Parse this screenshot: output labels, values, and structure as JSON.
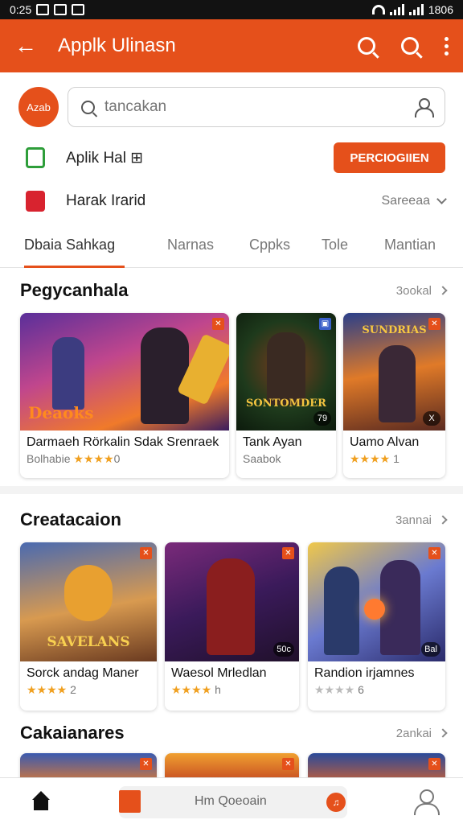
{
  "status_bar": {
    "time": "0:25",
    "battery": "1806"
  },
  "app_bar": {
    "title": "Applk Ulinasn"
  },
  "avatar": {
    "label": "Azab"
  },
  "search": {
    "value": "",
    "placeholder": "tancakan"
  },
  "apps_row": {
    "label": "Aplik Hal ⊞",
    "button": "PERCIOGIIEN"
  },
  "category_row": {
    "label": "Harak Irarid",
    "dropdown": "Sareeaa"
  },
  "tabs": [
    {
      "label": "Dbaia Sahkag",
      "active": true
    },
    {
      "label": "Narnas",
      "active": false
    },
    {
      "label": "Cppks",
      "active": false
    },
    {
      "label": "Tole",
      "active": false
    },
    {
      "label": "Mantian",
      "active": false
    }
  ],
  "sections": [
    {
      "title": "Pegycanhala",
      "see_all": "3ookal",
      "cards": [
        {
          "name": "Darmaeh Rörkalin Sdak Srenraek",
          "meta": "Bolhabie",
          "rating": "★★★★",
          "rating_suffix": "0",
          "art_text": "Deaoks",
          "tag": ""
        },
        {
          "name": "Tank Ayan",
          "meta": "Saabok",
          "rating": "",
          "rating_suffix": "",
          "art_text": "SONTOMDER",
          "tag": "79"
        },
        {
          "name": "Uamo Alvan",
          "meta": "",
          "rating": "★★★★",
          "rating_suffix": "1",
          "art_text": "SUNDRIAS",
          "tag": "X"
        }
      ]
    },
    {
      "title": "Creatacaion",
      "see_all": "3annai",
      "cards": [
        {
          "name": "Sorck andag Maner",
          "meta": "",
          "rating": "★★★★",
          "rating_suffix": "2",
          "art_text": "SAVELANS",
          "tag": ""
        },
        {
          "name": "Waesol Mrledlan",
          "meta": "",
          "rating": "★★★★",
          "rating_suffix": "h",
          "art_text": "",
          "tag": "50c"
        },
        {
          "name": "Randion irjamnes",
          "meta": "",
          "rating": "★★★★",
          "rating_suffix": "6",
          "art_text": "",
          "tag": "Bal"
        }
      ]
    },
    {
      "title": "Cakaianares",
      "see_all": "2ankai"
    }
  ],
  "bottom_nav": {
    "search_text": "Hm Qoeoain"
  },
  "colors": {
    "accent": "#e5501b",
    "star": "#f0a020"
  }
}
